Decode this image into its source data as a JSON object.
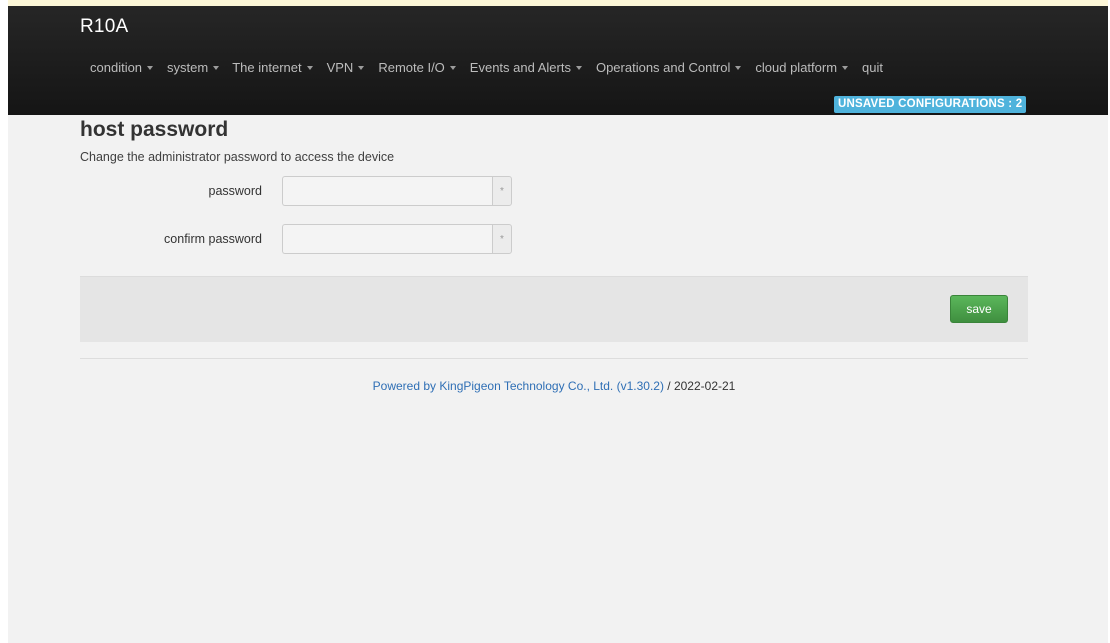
{
  "header": {
    "brand": "R10A",
    "menu": [
      {
        "label": "condition",
        "dropdown": true
      },
      {
        "label": "system",
        "dropdown": true
      },
      {
        "label": "The internet",
        "dropdown": true
      },
      {
        "label": "VPN",
        "dropdown": true
      },
      {
        "label": "Remote I/O",
        "dropdown": true
      },
      {
        "label": "Events and Alerts",
        "dropdown": true
      },
      {
        "label": "Operations and Control",
        "dropdown": true
      },
      {
        "label": "cloud platform",
        "dropdown": true
      },
      {
        "label": "quit",
        "dropdown": false
      }
    ],
    "unsaved_badge": "UNSAVED CONFIGURATIONS : 2"
  },
  "page": {
    "title": "host password",
    "description": "Change the administrator password to access the device"
  },
  "form": {
    "password_label": "password",
    "password_value": "",
    "password_toggle": "*",
    "confirm_label": "confirm password",
    "confirm_value": "",
    "confirm_toggle": "*"
  },
  "actions": {
    "save_label": "save"
  },
  "footer": {
    "powered_by": "Powered by KingPigeon Technology Co., Ltd. (v1.30.2)",
    "date_suffix": " / 2022-02-21"
  },
  "colors": {
    "navbar": "#1c1c1c",
    "badge": "#4fb3dc",
    "save_button": "#4ca64c",
    "link": "#2f6fb5",
    "page_background": "#f2f2f2"
  }
}
